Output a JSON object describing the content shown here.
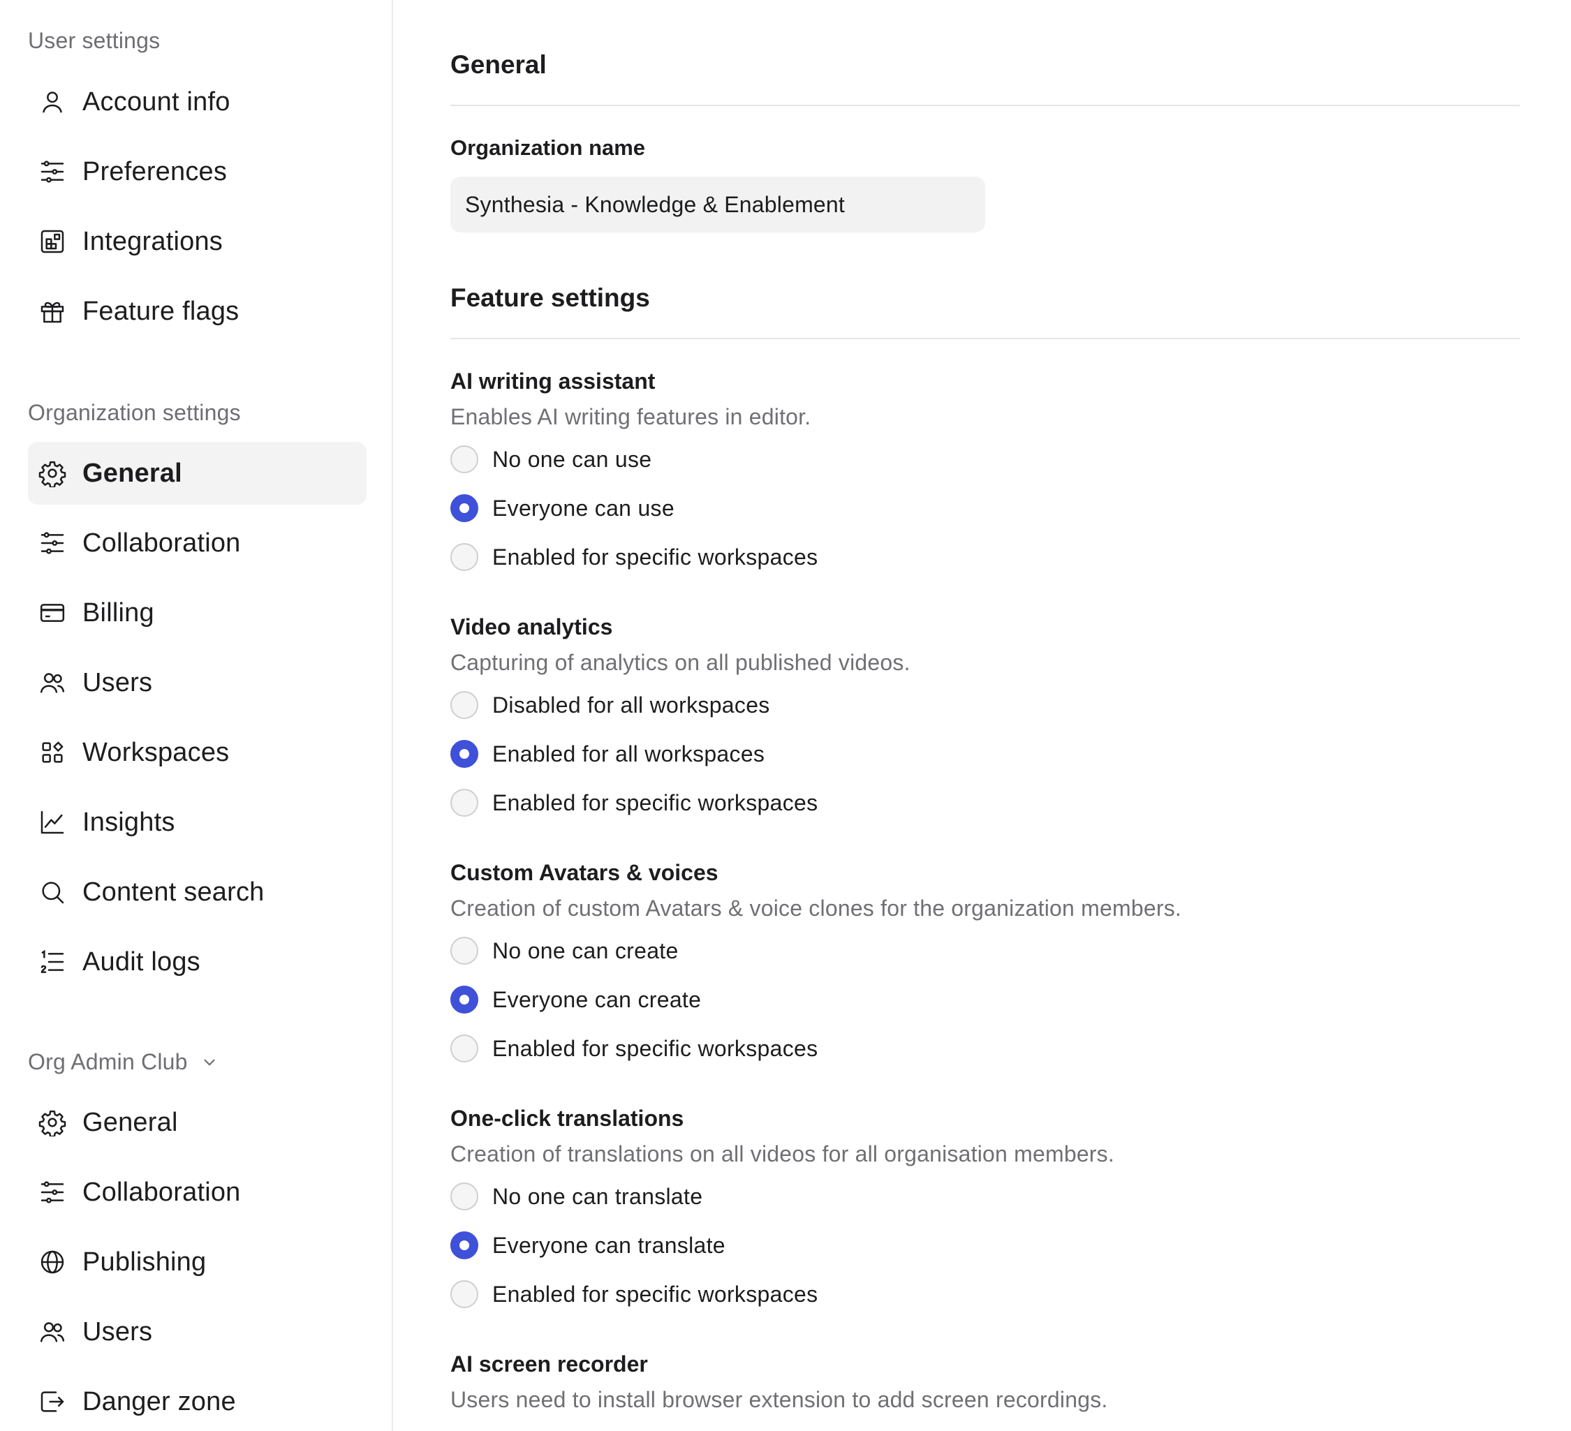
{
  "sidebar": {
    "user_settings_title": "User settings",
    "user_items": [
      {
        "label": "Account info",
        "icon": "user-icon"
      },
      {
        "label": "Preferences",
        "icon": "sliders-icon"
      },
      {
        "label": "Integrations",
        "icon": "integrations-icon"
      },
      {
        "label": "Feature flags",
        "icon": "gift-icon"
      }
    ],
    "org_settings_title": "Organization settings",
    "org_items": [
      {
        "label": "General",
        "icon": "gear-icon",
        "active": true
      },
      {
        "label": "Collaboration",
        "icon": "sliders-icon"
      },
      {
        "label": "Billing",
        "icon": "credit-card-icon"
      },
      {
        "label": "Users",
        "icon": "users-icon"
      },
      {
        "label": "Workspaces",
        "icon": "workspaces-icon"
      },
      {
        "label": "Insights",
        "icon": "chart-icon"
      },
      {
        "label": "Content search",
        "icon": "search-icon"
      },
      {
        "label": "Audit logs",
        "icon": "list-icon"
      }
    ],
    "club_title": "Org Admin Club",
    "club_items": [
      {
        "label": "General",
        "icon": "gear-icon"
      },
      {
        "label": "Collaboration",
        "icon": "sliders-icon"
      },
      {
        "label": "Publishing",
        "icon": "globe-icon"
      },
      {
        "label": "Users",
        "icon": "users-icon"
      },
      {
        "label": "Danger zone",
        "icon": "exit-icon"
      }
    ]
  },
  "main": {
    "title": "General",
    "org_name_label": "Organization name",
    "org_name_value": "Synthesia - Knowledge & Enablement",
    "feature_settings_title": "Feature settings",
    "features": [
      {
        "title": "AI writing assistant",
        "description": "Enables AI writing features in editor.",
        "options": [
          "No one can use",
          "Everyone can use",
          "Enabled for specific workspaces"
        ],
        "selected": 1
      },
      {
        "title": "Video analytics",
        "description": "Capturing of analytics on all published videos.",
        "options": [
          "Disabled for all workspaces",
          "Enabled for all workspaces",
          "Enabled for specific workspaces"
        ],
        "selected": 1
      },
      {
        "title": "Custom Avatars & voices",
        "description": "Creation of custom Avatars & voice clones for the organization members.",
        "options": [
          "No one can create",
          "Everyone can create",
          "Enabled for specific workspaces"
        ],
        "selected": 1
      },
      {
        "title": "One-click translations",
        "description": "Creation of translations on all videos for all organisation members.",
        "options": [
          "No one can translate",
          "Everyone can translate",
          "Enabled for specific workspaces"
        ],
        "selected": 1
      },
      {
        "title": "AI screen recorder",
        "description": "Users need to install browser extension to add screen recordings.",
        "options": []
      }
    ]
  },
  "colors": {
    "accent": "#3f51d8",
    "active_bg": "#f3f3f4",
    "muted_text": "#707074"
  }
}
